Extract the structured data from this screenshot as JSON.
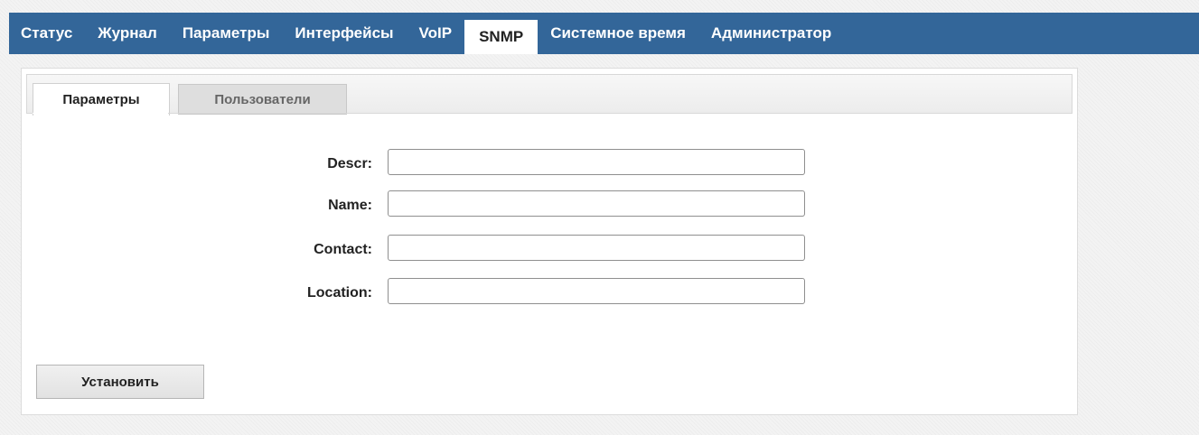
{
  "nav": {
    "items": [
      {
        "label": "Статус"
      },
      {
        "label": "Журнал"
      },
      {
        "label": "Параметры"
      },
      {
        "label": "Интерфейсы"
      },
      {
        "label": "VoIP"
      },
      {
        "label": "SNMP"
      },
      {
        "label": "Системное время"
      },
      {
        "label": "Администратор"
      }
    ],
    "active": "SNMP"
  },
  "tabs": {
    "items": [
      {
        "label": "Параметры"
      },
      {
        "label": "Пользователи"
      }
    ],
    "active": "Параметры"
  },
  "form": {
    "fields": [
      {
        "label": "Descr:",
        "value": ""
      },
      {
        "label": "Name:",
        "value": ""
      },
      {
        "label": "Contact:",
        "value": ""
      },
      {
        "label": "Location:",
        "value": ""
      }
    ],
    "submit_label": "Установить"
  },
  "colors": {
    "nav_background": "#336699",
    "nav_text": "#ffffff",
    "active_tab_background": "#ffffff"
  }
}
